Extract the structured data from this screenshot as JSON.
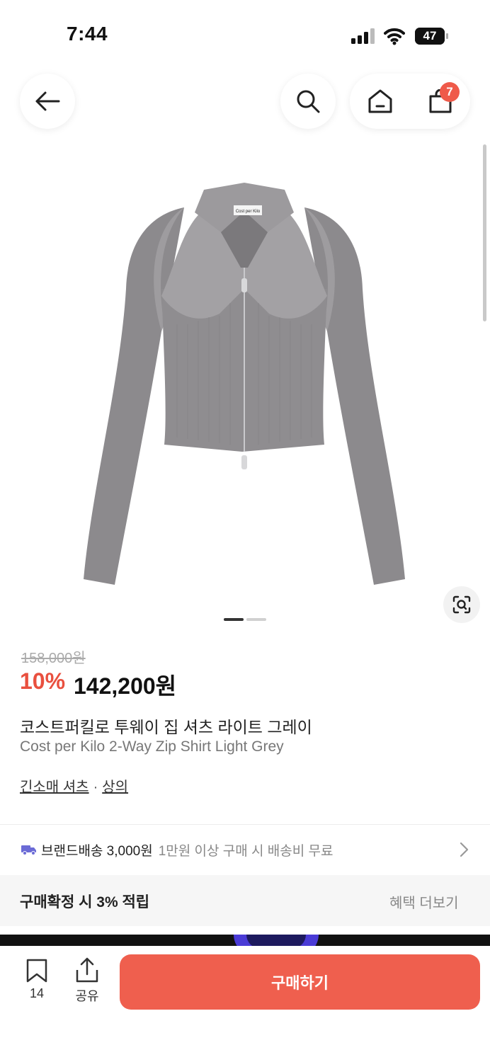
{
  "status_bar": {
    "time": "7:44",
    "battery": "47"
  },
  "nav": {
    "back_icon": "arrow-left-icon",
    "search_icon": "search-icon",
    "home_icon": "home-icon",
    "cart_icon": "shopping-bag-icon",
    "cart_count": "7"
  },
  "product": {
    "image_label": "Cost per Kilo",
    "image_index": 1,
    "image_total": 2,
    "original_price": "158,000원",
    "discount": "10%",
    "price": "142,200원",
    "name_ko": "코스트퍼킬로 투웨이 집 셔츠 라이트 그레이",
    "name_en": "Cost per Kilo 2-Way Zip Shirt Light Grey",
    "category": "긴소매 셔츠",
    "category_sep": "·",
    "category_parent": "상의"
  },
  "shipping": {
    "label": "브랜드배송 3,000원",
    "note": "1만원 이상 구매 시 배송비 무료"
  },
  "benefit": {
    "text": "구매확정 시 3% 적립",
    "more": "혜택 더보기"
  },
  "bottom_bar": {
    "bookmark_count": "14",
    "share_label": "공유",
    "buy_label": "구매하기"
  },
  "colors": {
    "accent": "#ef5f4e",
    "discount": "#e9503f",
    "shipping_icon": "#6b6bd6"
  }
}
